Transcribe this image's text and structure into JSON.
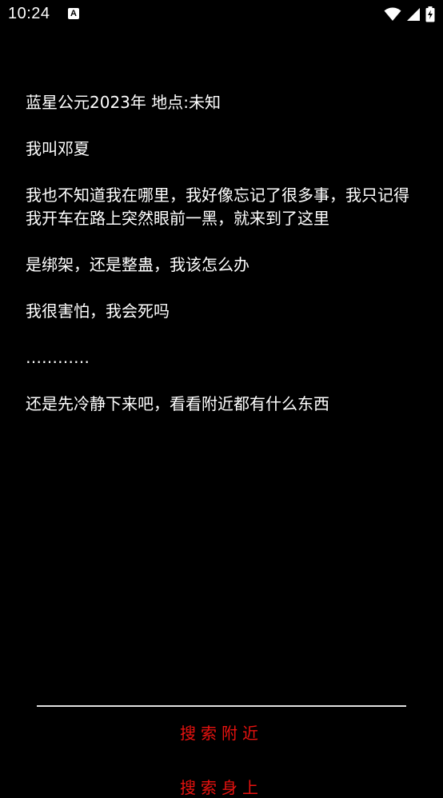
{
  "status_bar": {
    "time": "10:24",
    "notification_icon": "font-a-icon",
    "icons": [
      "wifi-icon",
      "signal-icon",
      "battery-charging-icon"
    ]
  },
  "story": {
    "lines": [
      "蓝星公元2023年 地点:未知",
      "我叫邓夏",
      "我也不知道我在哪里，我好像忘记了很多事，我只记得我开车在路上突然眼前一黑，就来到了这里",
      "是绑架，还是整蛊，我该怎么办",
      "我很害怕，我会死吗",
      "…………",
      "还是先冷静下来吧，看看附近都有什么东西"
    ]
  },
  "actions": {
    "search_nearby_label": "搜索附近",
    "second_label": "搜索身上"
  },
  "colors": {
    "background": "#000000",
    "text": "#ffffff",
    "action": "#e8120f",
    "divider": "#e0e0e0"
  }
}
